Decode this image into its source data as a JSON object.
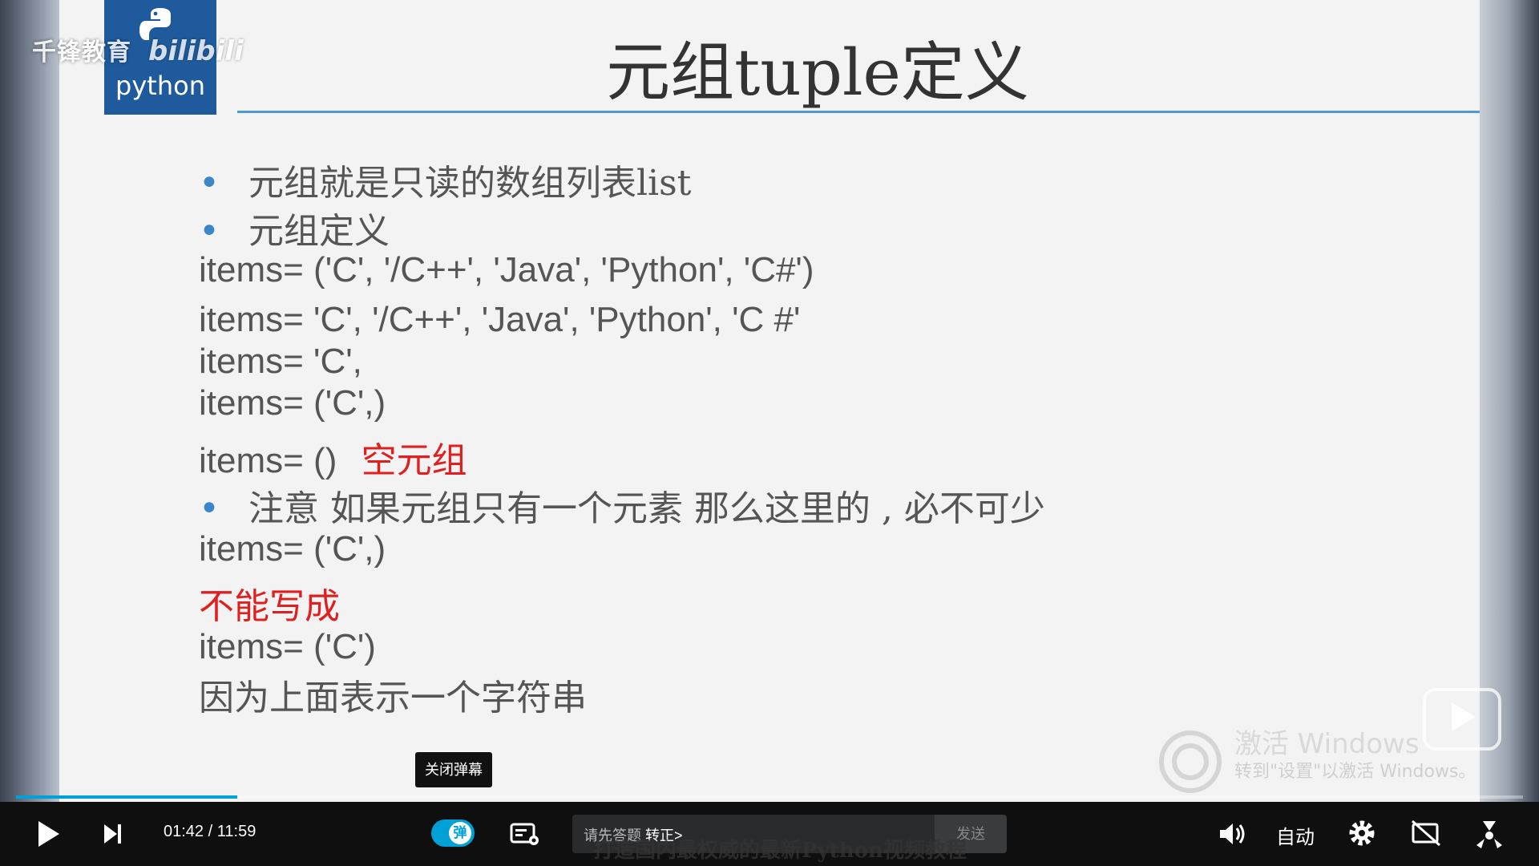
{
  "brand": {
    "overlay_text": "千锋教育",
    "bili_text": "bilibili",
    "logo_word": "python"
  },
  "slide": {
    "title": "元组tuple定义",
    "lines": [
      {
        "prefix": "•",
        "text": "元组就是只读的数组列表list"
      },
      {
        "prefix": "•",
        "text": "元组定义"
      },
      {
        "text": "items= ('C', '/C++', 'Java', 'Python', 'C#')"
      },
      {
        "text": "items= 'C', '/C++', 'Java', 'Python', 'C #'"
      },
      {
        "text": "items= 'C',"
      },
      {
        "text": "items= ('C',)"
      },
      {
        "text": "items= ()",
        "note": "空元组"
      },
      {
        "prefix": "•",
        "text": "注意 如果元组只有一个元素 那么这里的 , 必不可少"
      },
      {
        "text": "items= ('C',)"
      },
      {
        "text": "不能写成"
      },
      {
        "text": "items= ('C')"
      },
      {
        "text": "因为上面表示一个字符串"
      }
    ]
  },
  "watermark": {
    "line1": "激活 Windows",
    "line2": "转到\"设置\"以激活 Windows。",
    "brand_faint": "千锋教育"
  },
  "tooltip": "关闭弹幕",
  "player": {
    "progress": 0.1467,
    "current_time": "01:42",
    "duration": "11:59",
    "danmaku_label": "弹",
    "danmaku_placeholder": "请先答题",
    "danmaku_link": "转正>",
    "send_label": "发送",
    "subtitle_overlay": "打造国内最权威的最新Python视频教程",
    "quality_label": "自动",
    "colors": {
      "accent": "#00a1d6",
      "slide_accent": "#4e9ad1",
      "red": "#e02020"
    }
  }
}
